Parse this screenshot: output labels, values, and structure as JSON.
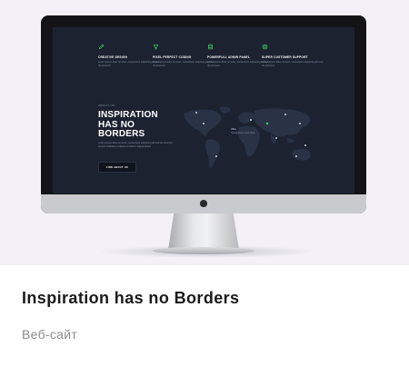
{
  "card": {
    "title": "Inspiration has no Borders",
    "subtitle": "Веб-сайт"
  },
  "site": {
    "features": [
      {
        "icon": "pencil-icon",
        "title": "CREATIVE DESIGN",
        "text": "Lorem ipsum dolor sit amet, consectetur adipiscing elit sed do eiusmod"
      },
      {
        "icon": "cup-icon",
        "title": "PIXEL PERFECT CODING",
        "text": "Lorem ipsum dolor sit amet, consectetur adipiscing elit sed do eiusmod"
      },
      {
        "icon": "layers-icon",
        "title": "POWERFULL ADMIN PANEL",
        "text": "Lorem ipsum dolor sit amet, consectetur adipiscing elit sed do eiusmod"
      },
      {
        "icon": "support-icon",
        "title": "SUPER CUSTOMER SUPPORT",
        "text": "Lorem ipsum dolor sit amet, consectetur adipiscing elit sed do eiusmod"
      }
    ],
    "eyebrow": "ABOUT US",
    "hero_line1": "INSPIRATION",
    "hero_line2": "HAS NO BORDERS",
    "hero_text": "Lorem ipsum dolor sit amet, consectetur adipiscing elit sed do eiusmod tempor incididunt ut labore et dolore magna aliqua.",
    "cta_label": "FIND ABOUT US",
    "map_label_title": "Office",
    "map_label_text": "Headquarters, main office",
    "accent_color": "#3ddc5c"
  }
}
